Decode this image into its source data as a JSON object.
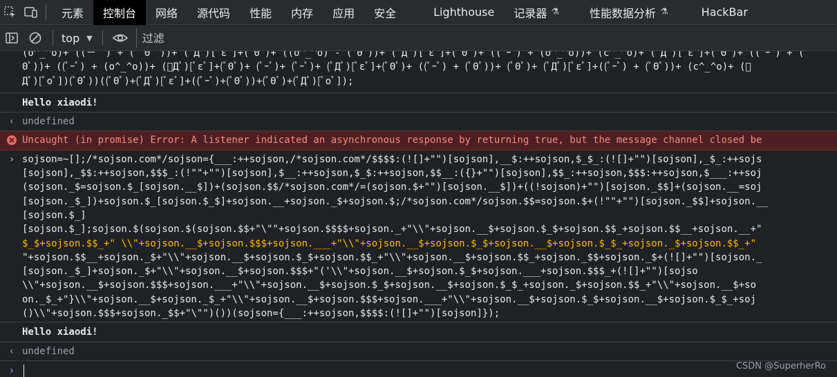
{
  "tabs": [
    "元素",
    "控制台",
    "网络",
    "源代码",
    "性能",
    "内存",
    "应用",
    "安全",
    "Lighthouse",
    "记录器",
    "性能数据分析",
    "HackBar"
  ],
  "active_tab": "控制台",
  "toolbar": {
    "context_label": "top",
    "filter_placeholder": "过滤"
  },
  "console": {
    "aaencode_lines": [
      "(o^_^o)+ ((－゜) + (゜Θ゜))+ (ﾟДﾟ)[ﾟεﾟ]+(ﾟΘﾟ)+ ((o^_^o) - (ﾟΘﾟ))+ (ﾟДﾟ)[ﾟεﾟ]+(ﾟΘﾟ)+ ((ﾟｰﾟ) + (o^_^o))+ (c^_^o)+ (ﾟДﾟ)[ﾟεﾟ]+(ﾟΘﾟ)+ ((ﾟｰﾟ) + (ﾟ",
      "Θﾟ))+ ((ﾟｰﾟ) + (o^_^o))+ (ﾟДﾟ)[ﾟεﾟ]+(ﾟΘﾟ)+ (ﾟｰﾟ)+ (ﾟｰﾟ)+ (ﾟДﾟ)[ﾟεﾟ]+(ﾟΘﾟ)+ ((ﾟｰﾟ) + (ﾟΘﾟ))+ (ﾟΘﾟ)+ (ﾟДﾟ)[ﾟεﾟ]+((ﾟｰﾟ) + (ﾟΘﾟ))+ (c^_^o)+ (ﾟ",
      "Дﾟ)[ﾟoﾟ])(ﾟΘﾟ))((ﾟΘﾟ)+(ﾟДﾟ)[ﾟεﾟ]+((ﾟｰﾟ)+(ﾟΘﾟ))+(ﾟΘﾟ)+(ﾟДﾟ)[ﾟoﾟ]);"
    ],
    "hello_1": "Hello xiaodi!",
    "undefined_1": "undefined",
    "error_text": "Uncaught (in promise) Error: A listener indicated an asynchronous response by returning true, but the message channel closed be",
    "jsfuck_lines": [
      "sojson=~[];/*sojson.com*/sojson={___:++sojson,/*sojson.com*/$$$$:(![]+\"\")[sojson],__$:++sojson,$_$_:(![]+\"\")[sojson],_$_:++sojs",
      "[sojson],_$$:++sojson,$$$_:(!\"\"+\"\")[sojson],$__:++sojson,$_$:++sojson,$$__:({}+\"\")[sojson],$$_:++sojson,$$$:++sojson,$___:++soj",
      "(sojson._$=sojson.$_[sojson.__$])+(sojson.$$/*sojson.com*/=(sojson.$+\"\")[sojson.__$])+((!sojson)+\"\")[sojson._$$]+(sojson.__=soj",
      "[sojson._$_])+sojson.$_[sojson.$_$]+sojson.__+sojson._$+sojson.$;/*sojson.com*/sojson.$$=sojson.$+(!\"\"+\"\")[sojson._$$]+sojson.__",
      "[sojson.$_]",
      "[sojson.$_];sojson.$(sojson.$(sojson.$$+\"\\\"\"+sojson.$$$$+sojson._+\"\\\\\"+sojson.__$+sojson.$_$+sojson.$$_+sojson.$$__+sojson.__+\"",
      "$_$+sojson.$$_+\" \\\\\"+sojson.__$+sojson.$$$+sojson.___+\"\\\\\"+sojson.__$+sojson.$_$+sojson.__$+sojson.$_$_+sojson._$+sojson.$$_+\"",
      "\"+sojson.$$__+sojson._$+\"\\\\\"+sojson.__$+sojson.$_$+sojson.$$_+\"\\\\\"+sojson.__$+sojson.$$_+sojson._$$+sojson._$+(![]+\"\")[sojson._",
      "[sojson._$_]+sojson._$+\"\\\\\"+sojson.__$+sojson.$$$+\"('\\\\\"+sojson.__$+sojson.$_$+sojson.___+sojson.$$$_+(![]+\"\")[sojso",
      "\\\\\"+sojson.__$+sojson.$$$+sojson.___+\"\\\\\"+sojson.__$+sojson.$_$+sojson.__$+sojson.$_$_+sojson._$+sojson.$$_+\"\\\\\"+sojson.__$+so",
      "on._$_+\"}\\\\\"+sojson.__$+sojson._$_+\"\\\\\"+sojson.__$+sojson.$$$+sojson.___+\"\\\\\"+sojson.__$+sojson.$_$+sojson.__$+sojson.$_$_+soj",
      "()\\\\\"+sojson.$$$+sojson._$$+\"\\\"\")())(sojson={___:++sojson,$$$$:(![]+\"\")[sojson]});"
    ],
    "hello_2": "Hello xiaodi!",
    "undefined_2": "undefined"
  },
  "watermark": "CSDN @SuperherRo"
}
